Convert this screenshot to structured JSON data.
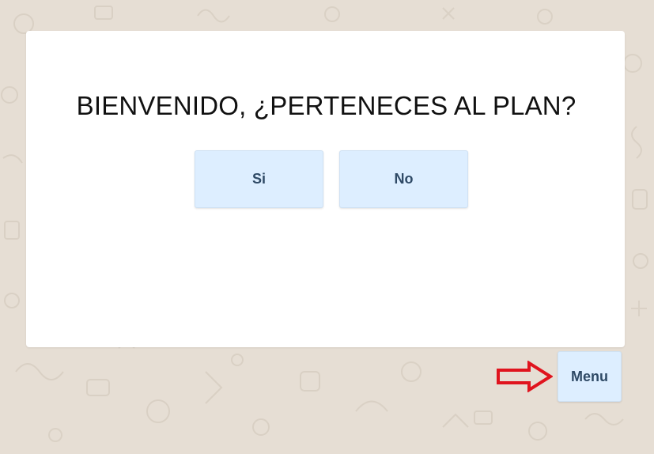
{
  "dialog": {
    "title": "BIENVENIDO, ¿PERTENECES AL PLAN?",
    "buttons": {
      "yes_label": "Si",
      "no_label": "No"
    }
  },
  "menu": {
    "label": "Menu"
  },
  "annotation": {
    "arrow_icon": "right-arrow-outline-icon",
    "arrow_color": "#e0141e"
  },
  "colors": {
    "background": "#e6ded4",
    "button_fill": "#ddeeff",
    "button_text": "#2f4a66",
    "title_text": "#111111"
  }
}
